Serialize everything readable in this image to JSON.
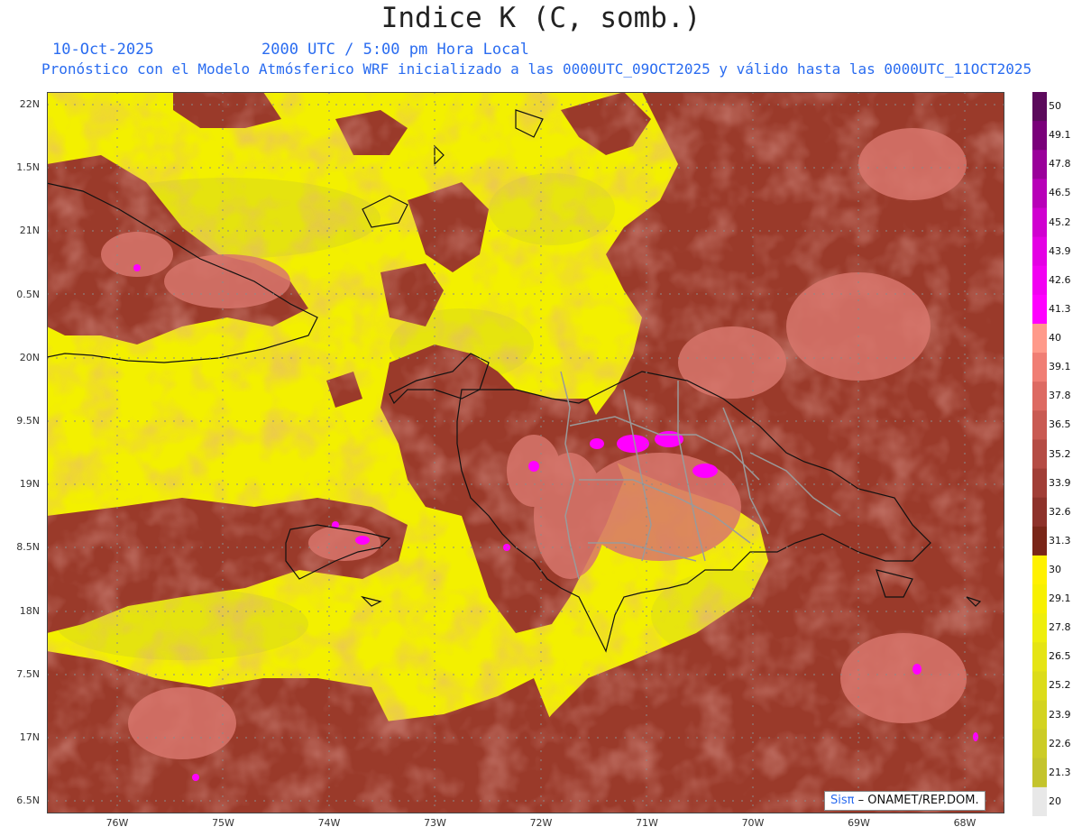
{
  "title": "Indice K (C, somb.)",
  "date": "10-Oct-2025",
  "time_label": "2000 UTC / 5:00 pm Hora Local",
  "model_line": "Pronóstico con el Modelo Atmósferico WRF inicializado a las 0000UTC_09OCT2025 y válido hasta las  0000UTC_11OCT2025",
  "lat_labels": [
    "22N",
    "1.5N",
    "21N",
    "0.5N",
    "20N",
    "9.5N",
    "19N",
    "8.5N",
    "18N",
    "7.5N",
    "17N",
    "6.5N"
  ],
  "lon_labels": [
    "76W",
    "75W",
    "74W",
    "73W",
    "72W",
    "71W",
    "70W",
    "69W",
    "68W"
  ],
  "colorbar": {
    "labels": [
      "50",
      "49.1",
      "47.8",
      "46.5",
      "45.2",
      "43.9",
      "42.6",
      "41.3",
      "40",
      "39.1",
      "37.8",
      "36.5",
      "35.2",
      "33.9",
      "32.6",
      "31.3",
      "30",
      "29.1",
      "27.8",
      "26.5",
      "25.2",
      "23.9",
      "22.6",
      "21.3",
      "20"
    ],
    "colors": [
      "#5c0a5c",
      "#7a007a",
      "#9a009a",
      "#b800b8",
      "#d000d0",
      "#e400e4",
      "#f200f2",
      "#ff00ff",
      "#ff9a8a",
      "#f07e74",
      "#dd6a62",
      "#c95a52",
      "#b54c44",
      "#a13e36",
      "#8e322a",
      "#7a2618",
      "#fff100",
      "#f7f000",
      "#eeee0c",
      "#e5e414",
      "#dcdc1a",
      "#d3d320",
      "#cccc26",
      "#c4c42c",
      "#e8e8e8"
    ]
  },
  "credit": {
    "brand": "Sisπ",
    "text": " – ONAMET/REP.DOM."
  }
}
